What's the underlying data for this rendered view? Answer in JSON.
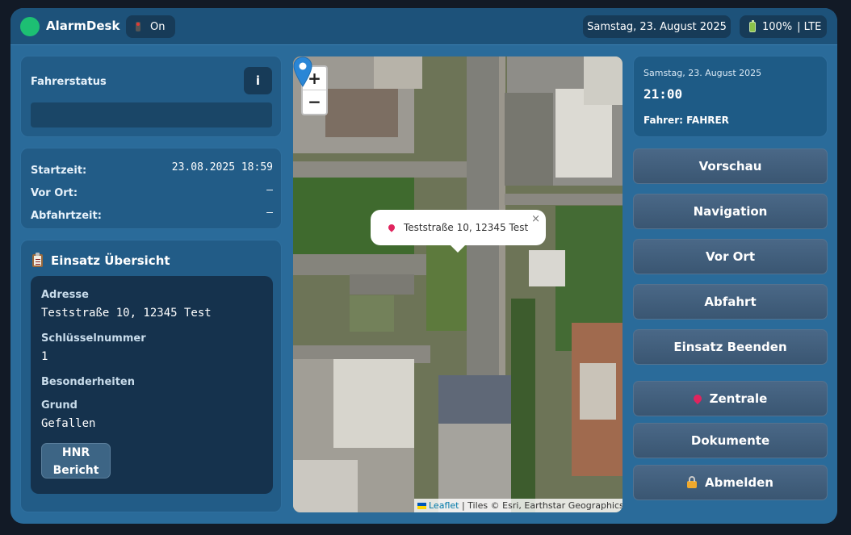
{
  "topbar": {
    "brand": "AlarmDesk",
    "status_label": "On",
    "date": "Samstag, 23. August 2025",
    "battery": "100%",
    "network": "| LTE"
  },
  "driver_status": {
    "title": "Fahrerstatus",
    "info_label": "i"
  },
  "times": [
    {
      "label": "Startzeit:",
      "value": "23.08.2025 18:59"
    },
    {
      "label": "Vor Ort:",
      "value": "–"
    },
    {
      "label": "Abfahrtzeit:",
      "value": "–"
    }
  ],
  "einsatz": {
    "title": "Einsatz Übersicht",
    "address_label": "Adresse",
    "address": "Teststraße 10, 12345 Test",
    "key_label": "Schlüsselnummer",
    "key": "1",
    "special_label": "Besonderheiten",
    "reason_label": "Grund",
    "reason": "Gefallen",
    "hnr_line1": "HNR",
    "hnr_line2": "Bericht"
  },
  "map": {
    "zoom_in": "+",
    "zoom_out": "−",
    "popup_text": "Teststraße 10, 12345 Test",
    "popup_close": "×",
    "attribution_link": "Leaflet",
    "attribution_text": " | Tiles © Esri, Earthstar Geographics"
  },
  "clock": {
    "date": "Samstag, 23. August 2025",
    "time": "21:00",
    "driver": "Fahrer: FAHRER"
  },
  "actions": {
    "preview": "Vorschau",
    "navigation": "Navigation",
    "on_site": "Vor Ort",
    "departure": "Abfahrt",
    "end": "Einsatz Beenden",
    "central": "Zentrale",
    "documents": "Dokumente",
    "logout": "Abmelden"
  },
  "colors": {
    "accent_green": "#1dbf73",
    "marker_blue": "#2a86d6",
    "pin_red": "#e0245e"
  }
}
